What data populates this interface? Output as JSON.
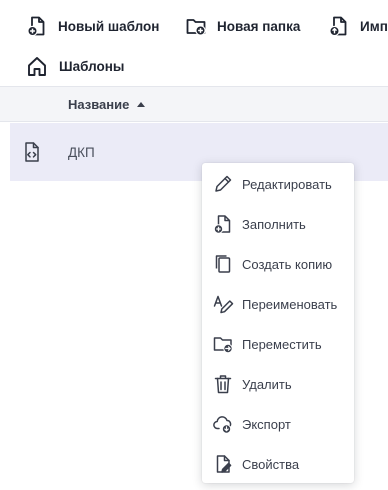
{
  "toolbar": {
    "new_template_label": "Новый шаблон",
    "new_folder_label": "Новая папка",
    "import_label": "Импо"
  },
  "breadcrumb": {
    "label": "Шаблоны"
  },
  "table": {
    "columns": [
      {
        "label": "Название",
        "sort": "ascending"
      }
    ],
    "rows": [
      {
        "name": "ДКП",
        "icon": "template-code-icon"
      }
    ]
  },
  "context_menu": {
    "items": [
      {
        "label": "Редактировать",
        "icon": "pencil-icon"
      },
      {
        "label": "Заполнить",
        "icon": "file-plus-icon"
      },
      {
        "label": "Создать копию",
        "icon": "copy-icon"
      },
      {
        "label": "Переименовать",
        "icon": "rename-icon"
      },
      {
        "label": "Переместить",
        "icon": "folder-move-icon"
      },
      {
        "label": "Удалить",
        "icon": "trash-icon"
      },
      {
        "label": "Экспорт",
        "icon": "cloud-export-icon"
      },
      {
        "label": "Свойства",
        "icon": "file-properties-icon"
      }
    ]
  },
  "colors": {
    "header_bg": "#f4f5f8",
    "selected_row_bg": "#ebebf7",
    "text": "#1f2430",
    "menu_text": "#3a3f4c"
  }
}
